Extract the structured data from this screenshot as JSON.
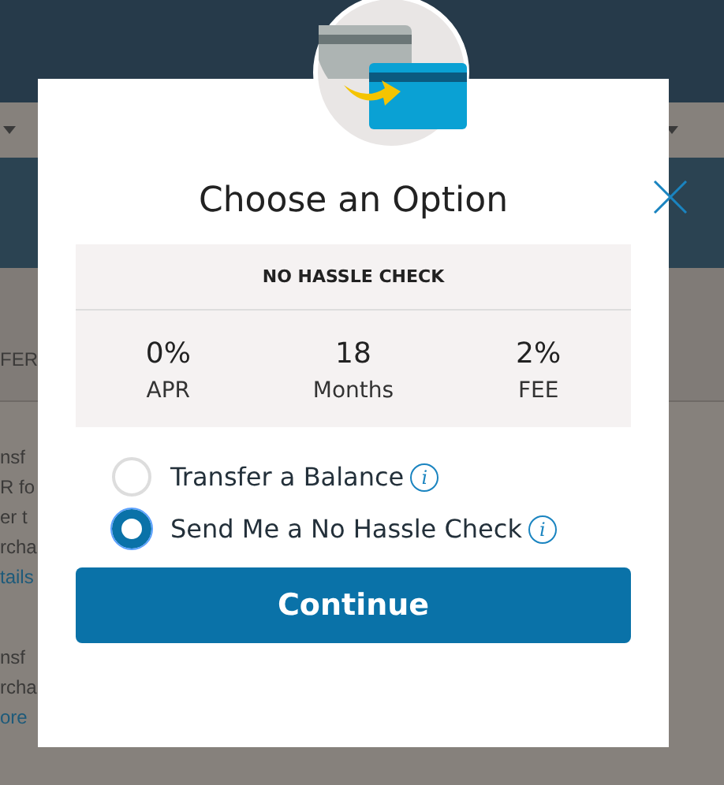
{
  "background": {
    "left_texts": [
      {
        "text": "FER",
        "kind": "plain"
      },
      {
        "text": "nsf",
        "kind": "plain"
      },
      {
        "text": "R fo",
        "kind": "plain"
      },
      {
        "text": "er t",
        "kind": "plain"
      },
      {
        "text": "rcha",
        "kind": "plain"
      },
      {
        "text": "tails",
        "kind": "link"
      },
      {
        "text": "nsf",
        "kind": "plain"
      },
      {
        "text": "rcha",
        "kind": "plain"
      },
      {
        "text": "ore",
        "kind": "link"
      }
    ]
  },
  "modal": {
    "title": "Choose an Option",
    "offer": {
      "heading": "NO HASSLE CHECK",
      "terms": [
        {
          "value": "0%",
          "label": "APR"
        },
        {
          "value": "18",
          "label": "Months"
        },
        {
          "value": "2%",
          "label": "FEE"
        }
      ]
    },
    "options": [
      {
        "label": "Transfer a Balance",
        "selected": false,
        "info": "i"
      },
      {
        "label": "Send Me a No Hassle Check",
        "selected": true,
        "info": "i"
      }
    ],
    "button": "Continue"
  }
}
